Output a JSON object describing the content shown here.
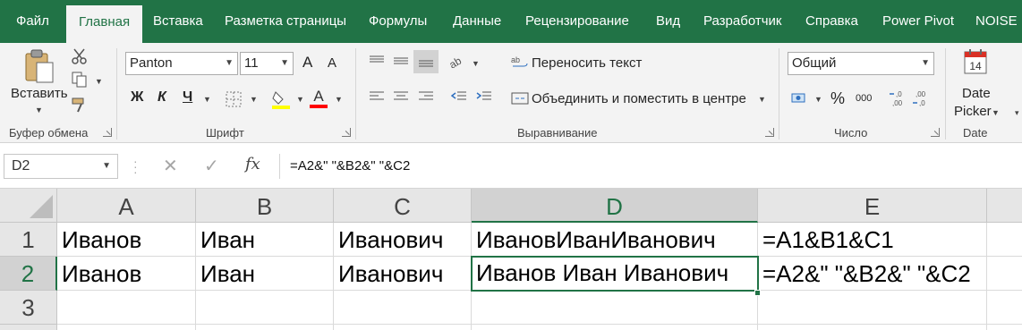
{
  "tabs": [
    {
      "label": "Файл",
      "active": false
    },
    {
      "label": "Главная",
      "active": true
    },
    {
      "label": "Вставка",
      "active": false
    },
    {
      "label": "Разметка страницы",
      "active": false
    },
    {
      "label": "Формулы",
      "active": false
    },
    {
      "label": "Данные",
      "active": false
    },
    {
      "label": "Рецензирование",
      "active": false
    },
    {
      "label": "Вид",
      "active": false
    },
    {
      "label": "Разработчик",
      "active": false
    },
    {
      "label": "Справка",
      "active": false
    },
    {
      "label": "Power Pivot",
      "active": false
    },
    {
      "label": "NOISE",
      "active": false
    }
  ],
  "ribbon": {
    "clipboard": {
      "paste_label": "Вставить",
      "group_label": "Буфер обмена"
    },
    "font": {
      "font_name": "Panton",
      "font_size": "11",
      "bold_label": "Ж",
      "italic_label": "К",
      "underline_label": "Ч",
      "grow_label": "A",
      "shrink_label": "A",
      "highlight_color": "#ffff00",
      "font_color": "#ff0000",
      "group_label": "Шрифт"
    },
    "alignment": {
      "wrap_label": "Переносить текст",
      "merge_label": "Объединить и поместить в центре",
      "group_label": "Выравнивание"
    },
    "number": {
      "format_value": "Общий",
      "percent_label": "%",
      "thousands_label": "000",
      "group_label": "Число"
    },
    "date": {
      "calendar_day": "14",
      "picker_line1": "Date",
      "picker_line2": "Picker",
      "group_label": "Date"
    }
  },
  "formula_bar": {
    "name_box": "D2",
    "fx_label": "fx",
    "formula": "=A2&\" \"&B2&\" \"&C2"
  },
  "grid": {
    "columns": [
      "A",
      "B",
      "C",
      "D",
      "E"
    ],
    "rows": [
      "1",
      "2",
      "3"
    ],
    "selected_column": "D",
    "selected_row": "2",
    "cells": {
      "A1": "Иванов",
      "B1": "Иван",
      "C1": "Иванович",
      "D1": "ИвановИванИванович",
      "E1": "=A1&B1&C1",
      "A2": "Иванов",
      "B2": "Иван",
      "C2": "Иванович",
      "D2": "Иванов Иван Иванович",
      "E2": "=A2&\" \"&B2&\" \"&C2"
    }
  },
  "colors": {
    "accent": "#217346",
    "ribbon_bg": "#f3f3f3",
    "header_bg": "#e6e6e6"
  }
}
